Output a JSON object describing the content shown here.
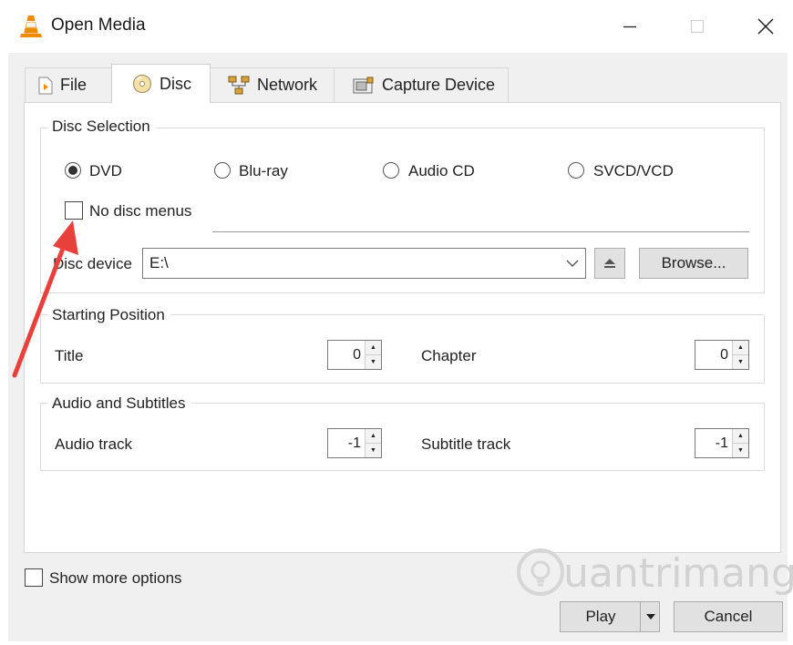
{
  "window": {
    "title": "Open Media"
  },
  "tabs": [
    {
      "label": "File",
      "icon": "file-icon"
    },
    {
      "label": "Disc",
      "icon": "disc-icon"
    },
    {
      "label": "Network",
      "icon": "network-icon"
    },
    {
      "label": "Capture Device",
      "icon": "capture-device-icon"
    }
  ],
  "active_tab": "Disc",
  "disc_selection": {
    "label": "Disc Selection",
    "options": [
      {
        "label": "DVD",
        "selected": true
      },
      {
        "label": "Blu-ray",
        "selected": false
      },
      {
        "label": "Audio CD",
        "selected": false
      },
      {
        "label": "SVCD/VCD",
        "selected": false
      }
    ],
    "no_disc_menus": {
      "label": "No disc menus",
      "checked": false
    },
    "device_label": "Disc device",
    "device_value": "E:\\",
    "browse_label": "Browse..."
  },
  "starting_position": {
    "label": "Starting Position",
    "title_label": "Title",
    "title_value": "0",
    "chapter_label": "Chapter",
    "chapter_value": "0"
  },
  "audio_subtitles": {
    "label": "Audio and Subtitles",
    "audio_label": "Audio track",
    "audio_value": "-1",
    "subtitle_label": "Subtitle track",
    "subtitle_value": "-1"
  },
  "show_more": {
    "label": "Show more options",
    "checked": false
  },
  "buttons": {
    "play": "Play",
    "cancel": "Cancel"
  },
  "watermark": "uantrimang",
  "colors": {
    "annotation_arrow": "#e8413c",
    "vlc_orange": "#f08a00"
  }
}
